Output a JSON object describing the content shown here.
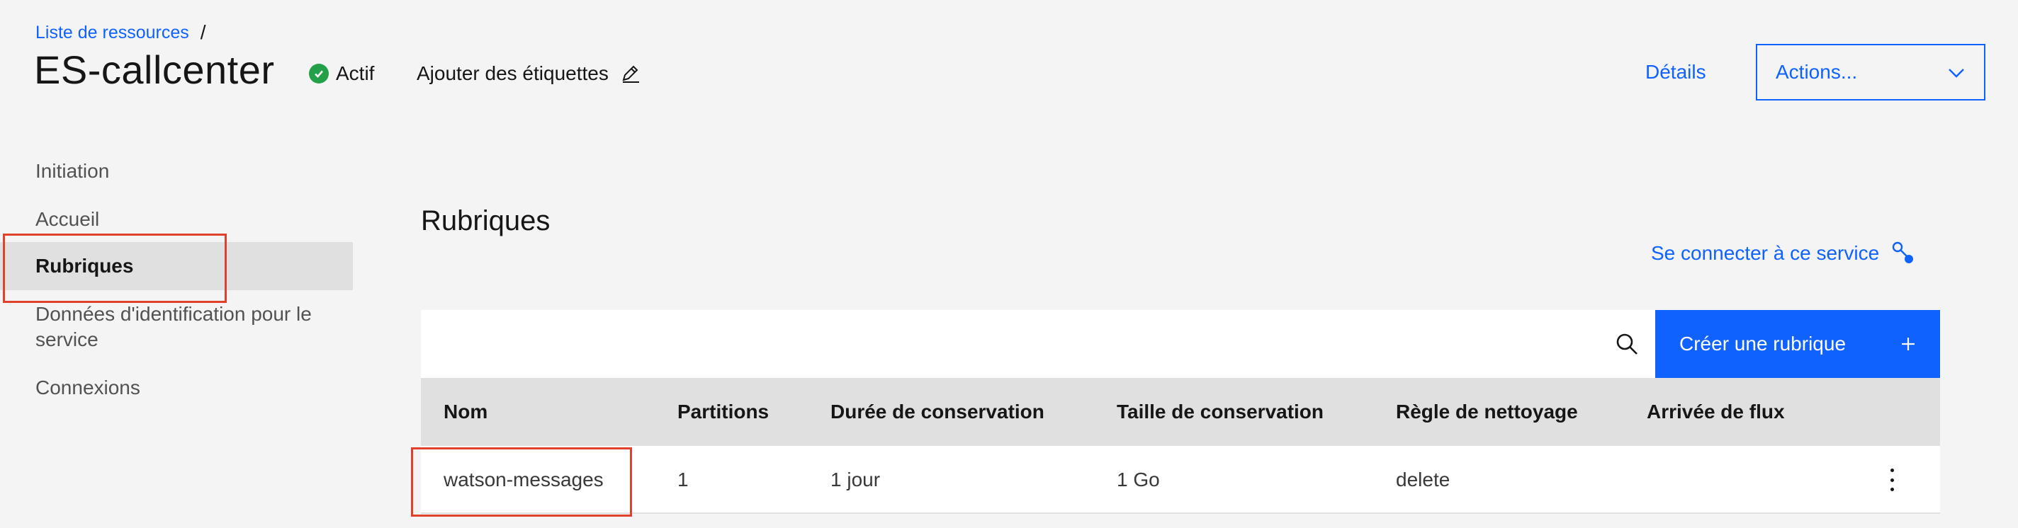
{
  "breadcrumb": {
    "link": "Liste de ressources",
    "separator": "/"
  },
  "header": {
    "title": "ES-callcenter",
    "status": "Actif",
    "add_tags": "Ajouter des étiquettes",
    "details": "Détails",
    "actions": "Actions..."
  },
  "sidebar": {
    "items": [
      {
        "label": "Initiation"
      },
      {
        "label": "Accueil"
      },
      {
        "label": "Rubriques"
      },
      {
        "label": "Données d'identification pour le service"
      },
      {
        "label": "Connexions"
      }
    ]
  },
  "main": {
    "title": "Rubriques",
    "connect": "Se connecter à ce service",
    "search_placeholder": "",
    "create_button": "Créer une rubrique",
    "columns": [
      "Nom",
      "Partitions",
      "Durée de conservation",
      "Taille de conservation",
      "Règle de nettoyage",
      "Arrivée de flux"
    ],
    "rows": [
      {
        "name": "watson-messages",
        "partitions": "1",
        "retention_time": "1 jour",
        "retention_size": "1 Go",
        "cleanup": "delete",
        "throughput": ""
      }
    ]
  },
  "colors": {
    "accent": "#0f62fe",
    "status_ok": "#24a148",
    "highlight": "#e0412b",
    "background": "#f4f4f4"
  },
  "icons": [
    "check-circle-icon",
    "pencil-icon",
    "chevron-down-icon",
    "connect-icon",
    "search-icon",
    "plus-icon",
    "overflow-menu-icon"
  ]
}
